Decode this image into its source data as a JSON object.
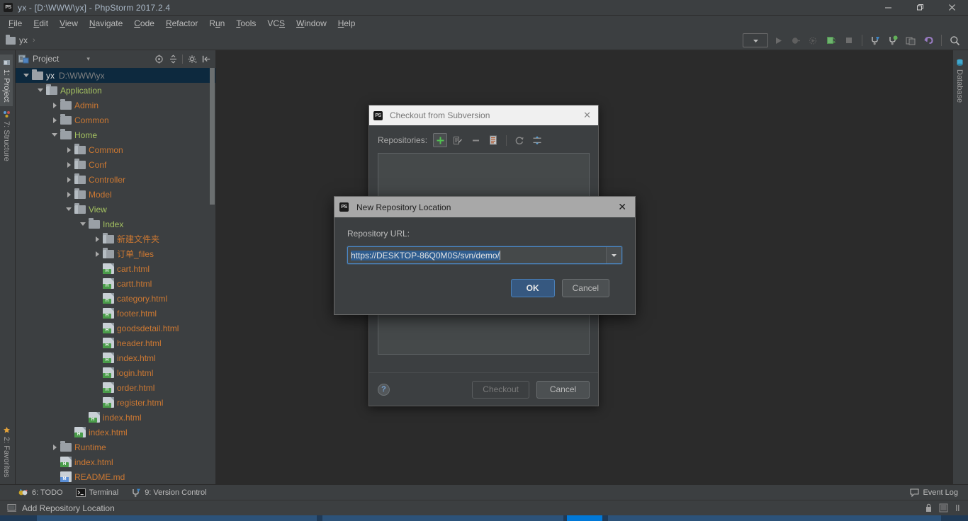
{
  "window": {
    "title": "yx - [D:\\WWW\\yx] - PhpStorm 2017.2.4",
    "logo": "phpstorm-logo",
    "minimize": "—",
    "maximize": "❐",
    "close": "✕"
  },
  "menu": [
    {
      "label": "File",
      "mnemonic": "F"
    },
    {
      "label": "Edit",
      "mnemonic": "E"
    },
    {
      "label": "View",
      "mnemonic": "V"
    },
    {
      "label": "Navigate",
      "mnemonic": "N"
    },
    {
      "label": "Code",
      "mnemonic": "C"
    },
    {
      "label": "Refactor",
      "mnemonic": "R"
    },
    {
      "label": "Run",
      "mnemonic": "u"
    },
    {
      "label": "Tools",
      "mnemonic": "T"
    },
    {
      "label": "VCS",
      "mnemonic": "S"
    },
    {
      "label": "Window",
      "mnemonic": "W"
    },
    {
      "label": "Help",
      "mnemonic": "H"
    }
  ],
  "navbar": {
    "crumb": "yx",
    "separator": "›"
  },
  "left_strip": {
    "project": "1: Project",
    "structure": "7: Structure",
    "favorites": "2: Favorites"
  },
  "right_strip": {
    "database": "Database"
  },
  "project_panel": {
    "title": "Project",
    "dropdown_arrow": "▾"
  },
  "tree": [
    {
      "depth": 0,
      "arrow": "open",
      "icon": "folder",
      "name": "yx",
      "path": "D:\\WWW\\yx",
      "color": "white",
      "selected": true
    },
    {
      "depth": 1,
      "arrow": "open",
      "icon": "folder-src",
      "name": "Application",
      "path": "",
      "color": "green",
      "selected": false
    },
    {
      "depth": 2,
      "arrow": "closed",
      "icon": "folder",
      "name": "Admin",
      "path": "",
      "color": "orange",
      "selected": false
    },
    {
      "depth": 2,
      "arrow": "closed",
      "icon": "folder",
      "name": "Common",
      "path": "",
      "color": "orange",
      "selected": false
    },
    {
      "depth": 2,
      "arrow": "open",
      "icon": "folder",
      "name": "Home",
      "path": "",
      "color": "green",
      "selected": false
    },
    {
      "depth": 3,
      "arrow": "closed",
      "icon": "folder-src",
      "name": "Common",
      "path": "",
      "color": "orange",
      "selected": false
    },
    {
      "depth": 3,
      "arrow": "closed",
      "icon": "folder-src",
      "name": "Conf",
      "path": "",
      "color": "orange",
      "selected": false
    },
    {
      "depth": 3,
      "arrow": "closed",
      "icon": "folder-src",
      "name": "Controller",
      "path": "",
      "color": "orange",
      "selected": false
    },
    {
      "depth": 3,
      "arrow": "closed",
      "icon": "folder-src",
      "name": "Model",
      "path": "",
      "color": "orange",
      "selected": false
    },
    {
      "depth": 3,
      "arrow": "open",
      "icon": "folder-src",
      "name": "View",
      "path": "",
      "color": "green",
      "selected": false
    },
    {
      "depth": 4,
      "arrow": "open",
      "icon": "folder",
      "name": "Index",
      "path": "",
      "color": "green",
      "selected": false
    },
    {
      "depth": 5,
      "arrow": "closed",
      "icon": "folder-src",
      "name": "新建文件夹",
      "path": "",
      "color": "orange",
      "selected": false
    },
    {
      "depth": 5,
      "arrow": "closed",
      "icon": "folder-src",
      "name": "订单_files",
      "path": "",
      "color": "orange",
      "selected": false
    },
    {
      "depth": 5,
      "arrow": "none",
      "icon": "html",
      "name": "cart.html",
      "path": "",
      "color": "orange",
      "selected": false
    },
    {
      "depth": 5,
      "arrow": "none",
      "icon": "html",
      "name": "cartt.html",
      "path": "",
      "color": "orange",
      "selected": false
    },
    {
      "depth": 5,
      "arrow": "none",
      "icon": "html",
      "name": "category.html",
      "path": "",
      "color": "orange",
      "selected": false
    },
    {
      "depth": 5,
      "arrow": "none",
      "icon": "html",
      "name": "footer.html",
      "path": "",
      "color": "orange",
      "selected": false
    },
    {
      "depth": 5,
      "arrow": "none",
      "icon": "html",
      "name": "goodsdetail.html",
      "path": "",
      "color": "orange",
      "selected": false
    },
    {
      "depth": 5,
      "arrow": "none",
      "icon": "html",
      "name": "header.html",
      "path": "",
      "color": "orange",
      "selected": false
    },
    {
      "depth": 5,
      "arrow": "none",
      "icon": "html",
      "name": "index.html",
      "path": "",
      "color": "orange",
      "selected": false
    },
    {
      "depth": 5,
      "arrow": "none",
      "icon": "html",
      "name": "login.html",
      "path": "",
      "color": "orange",
      "selected": false
    },
    {
      "depth": 5,
      "arrow": "none",
      "icon": "html",
      "name": "order.html",
      "path": "",
      "color": "orange",
      "selected": false
    },
    {
      "depth": 5,
      "arrow": "none",
      "icon": "html",
      "name": "register.html",
      "path": "",
      "color": "orange",
      "selected": false
    },
    {
      "depth": 4,
      "arrow": "none",
      "icon": "html",
      "name": "index.html",
      "path": "",
      "color": "orange",
      "selected": false
    },
    {
      "depth": 3,
      "arrow": "none",
      "icon": "html",
      "name": "index.html",
      "path": "",
      "color": "orange",
      "selected": false
    },
    {
      "depth": 2,
      "arrow": "closed",
      "icon": "folder",
      "name": "Runtime",
      "path": "",
      "color": "orange",
      "selected": false
    },
    {
      "depth": 2,
      "arrow": "none",
      "icon": "html",
      "name": "index.html",
      "path": "",
      "color": "orange",
      "selected": false
    },
    {
      "depth": 2,
      "arrow": "none",
      "icon": "md",
      "name": "README.md",
      "path": "",
      "color": "orange",
      "selected": false
    }
  ],
  "checkout_dialog": {
    "title": "Checkout from Subversion",
    "close": "✕",
    "repositories_label": "Repositories:",
    "toolbar": [
      {
        "name": "add-repository-icon",
        "glyph": "+",
        "selected": true
      },
      {
        "name": "edit-repository-icon",
        "glyph": "edit",
        "selected": false
      },
      {
        "name": "remove-repository-icon",
        "glyph": "—",
        "selected": false
      },
      {
        "name": "copy-url-icon",
        "glyph": "doc",
        "selected": false
      },
      {
        "name": "refresh-icon",
        "glyph": "refresh",
        "selected": false
      },
      {
        "name": "expand-settings-icon",
        "glyph": "filter",
        "selected": false
      }
    ],
    "help_glyph": "?",
    "checkout_label": "Checkout",
    "cancel_label": "Cancel"
  },
  "new_repo_dialog": {
    "title": "New Repository Location",
    "close": "✕",
    "url_label": "Repository URL:",
    "url_value": "https://DESKTOP-86Q0M0S/svn/demo/",
    "dropdown_arrow": "▼",
    "ok_label": "OK",
    "cancel_label": "Cancel"
  },
  "bottom_bar": {
    "todo": "6: TODO",
    "todo_mnemonic": "6",
    "terminal": "Terminal",
    "version_control": "9: Version Control",
    "vcs_mnemonic": "9",
    "event_log": "Event Log"
  },
  "status_bar": {
    "message": "Add Repository Location"
  },
  "colors": {
    "bg_panel": "#3c3f41",
    "bg_editor": "#2b2b2b",
    "accent_blue": "#365880",
    "selection_blue": "#0d293e",
    "folder_orange": "#cc7832",
    "folder_green": "#a5c261",
    "text": "#bbbbbb"
  }
}
